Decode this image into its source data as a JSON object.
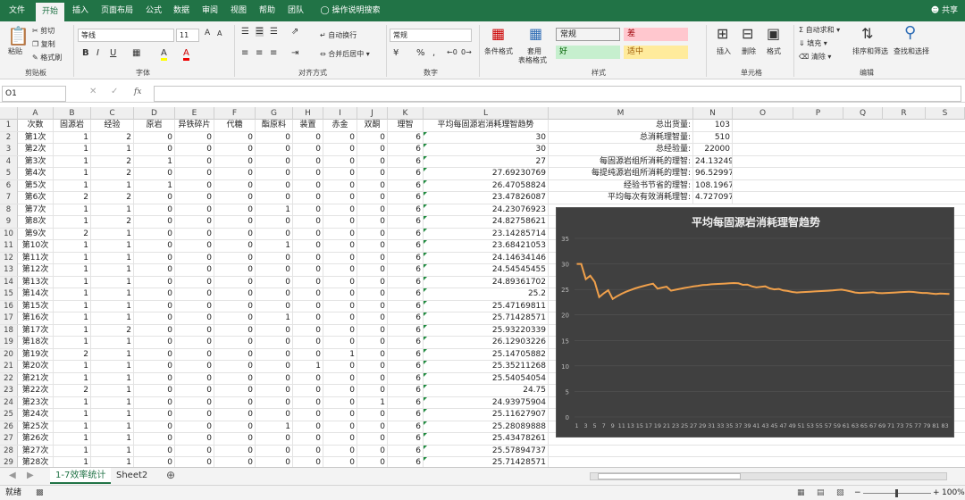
{
  "menu": {
    "tabs": [
      "文件",
      "开始",
      "插入",
      "页面布局",
      "公式",
      "数据",
      "审阅",
      "视图",
      "帮助",
      "团队",
      "操作说明搜索"
    ],
    "share": "共享"
  },
  "ribbon": {
    "clipboard": {
      "paste": "粘贴",
      "cut": "剪切",
      "copy": "复制",
      "format_painter": "格式刷",
      "label": "剪贴板"
    },
    "font": {
      "name": "等线",
      "size": "11",
      "label": "字体",
      "bold": "B",
      "italic": "I",
      "underline": "U",
      "grow": "A",
      "shrink": "A",
      "fill_a": "A",
      "font_color_a": "A"
    },
    "align": {
      "wrap": "自动换行",
      "merge": "合并后居中",
      "label": "对齐方式"
    },
    "number": {
      "format": "常规",
      "pct": "%",
      "comma": ",",
      "label": "数字"
    },
    "styles": {
      "cond": "条件格式",
      "table": "套用",
      "table2": "表格格式",
      "cells": [
        {
          "text": "常规",
          "bg": "#ffffff",
          "fg": "#222222"
        },
        {
          "text": "差",
          "bg": "#ffc7ce",
          "fg": "#9c0006"
        },
        {
          "text": "好",
          "bg": "#c6efce",
          "fg": "#006100"
        },
        {
          "text": "适中",
          "bg": "#ffeb9c",
          "fg": "#9c5700"
        }
      ],
      "label": "样式"
    },
    "cells_grp": {
      "insert": "插入",
      "delete": "删除",
      "format": "格式",
      "label": "单元格"
    },
    "editing": {
      "autosum": "自动求和",
      "fill": "填充",
      "clear": "清除",
      "sort": "排序和筛选",
      "find": "查找和选择",
      "label": "编辑"
    }
  },
  "formula": {
    "namebox": "O1",
    "fx": "fx",
    "value": ""
  },
  "columns": [
    "A",
    "B",
    "C",
    "D",
    "E",
    "F",
    "G",
    "H",
    "I",
    "J",
    "K",
    "L",
    "M",
    "N",
    "O",
    "P",
    "Q",
    "R",
    "S"
  ],
  "headers": [
    "次数",
    "固源岩",
    "经验",
    "原岩",
    "异铁碎片",
    "代糖",
    "酯原料",
    "装置",
    "赤金",
    "双酮",
    "理智",
    "平均每固源岩消耗理智趋势"
  ],
  "rows": [
    [
      "第1次",
      "1",
      "2",
      "0",
      "0",
      "0",
      "0",
      "0",
      "0",
      "0",
      "6",
      "30"
    ],
    [
      "第2次",
      "1",
      "1",
      "0",
      "0",
      "0",
      "0",
      "0",
      "0",
      "0",
      "6",
      "30"
    ],
    [
      "第3次",
      "1",
      "2",
      "1",
      "0",
      "0",
      "0",
      "0",
      "0",
      "0",
      "6",
      "27"
    ],
    [
      "第4次",
      "1",
      "2",
      "0",
      "0",
      "0",
      "0",
      "0",
      "0",
      "0",
      "6",
      "27.69230769"
    ],
    [
      "第5次",
      "1",
      "1",
      "1",
      "0",
      "0",
      "0",
      "0",
      "0",
      "0",
      "6",
      "26.47058824"
    ],
    [
      "第6次",
      "2",
      "2",
      "0",
      "0",
      "0",
      "0",
      "0",
      "0",
      "0",
      "6",
      "23.47826087"
    ],
    [
      "第7次",
      "1",
      "1",
      "0",
      "0",
      "0",
      "1",
      "0",
      "0",
      "0",
      "6",
      "24.23076923"
    ],
    [
      "第8次",
      "1",
      "2",
      "0",
      "0",
      "0",
      "0",
      "0",
      "0",
      "0",
      "6",
      "24.82758621"
    ],
    [
      "第9次",
      "2",
      "1",
      "0",
      "0",
      "0",
      "0",
      "0",
      "0",
      "0",
      "6",
      "23.14285714"
    ],
    [
      "第10次",
      "1",
      "1",
      "0",
      "0",
      "0",
      "1",
      "0",
      "0",
      "0",
      "6",
      "23.68421053"
    ],
    [
      "第11次",
      "1",
      "1",
      "0",
      "0",
      "0",
      "0",
      "0",
      "0",
      "0",
      "6",
      "24.14634146"
    ],
    [
      "第12次",
      "1",
      "1",
      "0",
      "0",
      "0",
      "0",
      "0",
      "0",
      "0",
      "6",
      "24.54545455"
    ],
    [
      "第13次",
      "1",
      "1",
      "0",
      "0",
      "0",
      "0",
      "0",
      "0",
      "0",
      "6",
      "24.89361702"
    ],
    [
      "第14次",
      "1",
      "1",
      "0",
      "0",
      "0",
      "0",
      "0",
      "0",
      "0",
      "6",
      "25.2"
    ],
    [
      "第15次",
      "1",
      "1",
      "0",
      "0",
      "0",
      "0",
      "0",
      "0",
      "0",
      "6",
      "25.47169811"
    ],
    [
      "第16次",
      "1",
      "1",
      "0",
      "0",
      "0",
      "1",
      "0",
      "0",
      "0",
      "6",
      "25.71428571"
    ],
    [
      "第17次",
      "1",
      "2",
      "0",
      "0",
      "0",
      "0",
      "0",
      "0",
      "0",
      "6",
      "25.93220339"
    ],
    [
      "第18次",
      "1",
      "1",
      "0",
      "0",
      "0",
      "0",
      "0",
      "0",
      "0",
      "6",
      "26.12903226"
    ],
    [
      "第19次",
      "2",
      "1",
      "0",
      "0",
      "0",
      "0",
      "0",
      "1",
      "0",
      "6",
      "25.14705882"
    ],
    [
      "第20次",
      "1",
      "1",
      "0",
      "0",
      "0",
      "0",
      "1",
      "0",
      "0",
      "6",
      "25.35211268"
    ],
    [
      "第21次",
      "1",
      "1",
      "0",
      "0",
      "0",
      "0",
      "0",
      "0",
      "0",
      "6",
      "25.54054054"
    ],
    [
      "第22次",
      "2",
      "1",
      "0",
      "0",
      "0",
      "0",
      "0",
      "0",
      "0",
      "6",
      "24.75"
    ],
    [
      "第23次",
      "1",
      "1",
      "0",
      "0",
      "0",
      "0",
      "0",
      "0",
      "1",
      "6",
      "24.93975904"
    ],
    [
      "第24次",
      "1",
      "1",
      "0",
      "0",
      "0",
      "0",
      "0",
      "0",
      "0",
      "6",
      "25.11627907"
    ],
    [
      "第25次",
      "1",
      "1",
      "0",
      "0",
      "0",
      "1",
      "0",
      "0",
      "0",
      "6",
      "25.28089888"
    ],
    [
      "第26次",
      "1",
      "1",
      "0",
      "0",
      "0",
      "0",
      "0",
      "0",
      "0",
      "6",
      "25.43478261"
    ],
    [
      "第27次",
      "1",
      "1",
      "0",
      "0",
      "0",
      "0",
      "0",
      "0",
      "0",
      "6",
      "25.57894737"
    ],
    [
      "第28次",
      "1",
      "1",
      "0",
      "0",
      "0",
      "0",
      "0",
      "0",
      "0",
      "6",
      "25.71428571"
    ],
    [
      "第29次",
      "1",
      "1",
      "0",
      "0",
      "0",
      "0",
      "0",
      "0",
      "0",
      "6",
      "25.84158416"
    ]
  ],
  "summary": [
    {
      "label": "总出货量:",
      "value": "103"
    },
    {
      "label": "总消耗理智量:",
      "value": "510"
    },
    {
      "label": "总经验量:",
      "value": "22000"
    },
    {
      "label": "每固源岩组所消耗的理智:",
      "value": "24.13249"
    },
    {
      "label": "每提纯源岩组所消耗的理智:",
      "value": "96.52997"
    },
    {
      "label": "经验书节省的理智:",
      "value": "108.1967"
    },
    {
      "label": "平均每次有效消耗理智:",
      "value": "4.727097"
    }
  ],
  "chart_data": {
    "type": "line",
    "title": "平均每固源岩消耗理智趋势",
    "ylim": [
      0,
      35
    ],
    "yticks": [
      0,
      5,
      10,
      15,
      20,
      25,
      30,
      35
    ],
    "line_color": "#f0a04b",
    "bg_color": "#404040",
    "x": [
      1,
      2,
      3,
      4,
      5,
      6,
      7,
      8,
      9,
      10,
      11,
      12,
      13,
      14,
      15,
      16,
      17,
      18,
      19,
      20,
      21,
      22,
      23,
      24,
      25,
      26,
      27,
      28,
      29,
      30,
      31,
      32,
      33,
      34,
      35,
      36,
      37,
      38,
      39,
      40,
      41,
      42,
      43,
      44,
      45,
      46,
      47,
      48,
      49,
      50,
      51,
      52,
      53,
      54,
      55,
      56,
      57,
      58,
      59,
      60,
      61,
      62,
      63,
      64,
      65,
      66,
      67,
      68,
      69,
      70,
      71,
      72,
      73,
      74,
      75,
      76,
      77,
      78,
      79,
      80,
      81,
      82,
      83,
      84
    ],
    "xtick_labels": [
      "1",
      "3",
      "5",
      "7",
      "9",
      "11",
      "13",
      "15",
      "17",
      "19",
      "21",
      "23",
      "25",
      "27",
      "29",
      "31",
      "33",
      "35",
      "37",
      "39",
      "41",
      "43",
      "45",
      "47",
      "49",
      "51",
      "53",
      "55",
      "57",
      "59",
      "61",
      "63",
      "65",
      "67",
      "69",
      "71",
      "73",
      "75",
      "77",
      "79",
      "81",
      "83"
    ],
    "values": [
      30,
      30,
      27,
      27.69,
      26.47,
      23.48,
      24.23,
      24.83,
      23.14,
      23.68,
      24.15,
      24.55,
      24.89,
      25.2,
      25.47,
      25.71,
      25.93,
      26.13,
      25.15,
      25.35,
      25.54,
      24.75,
      24.94,
      25.12,
      25.28,
      25.43,
      25.58,
      25.71,
      25.84,
      25.9,
      26.0,
      26.05,
      26.1,
      26.15,
      26.2,
      26.25,
      26.2,
      25.9,
      25.95,
      25.6,
      25.4,
      25.5,
      25.6,
      25.2,
      25.0,
      25.1,
      24.8,
      24.7,
      24.5,
      24.4,
      24.45,
      24.5,
      24.55,
      24.6,
      24.65,
      24.7,
      24.75,
      24.8,
      24.9,
      24.95,
      24.8,
      24.6,
      24.4,
      24.3,
      24.35,
      24.4,
      24.45,
      24.3,
      24.25,
      24.3,
      24.35,
      24.4,
      24.45,
      24.5,
      24.55,
      24.5,
      24.4,
      24.3,
      24.3,
      24.2,
      24.1,
      24.2,
      24.15,
      24.1
    ]
  },
  "sheets": [
    "1-7效率统计",
    "Sheet2"
  ],
  "status": {
    "ready": "就绪",
    "zoom": "100%",
    "minus": "−",
    "plus": "+"
  }
}
